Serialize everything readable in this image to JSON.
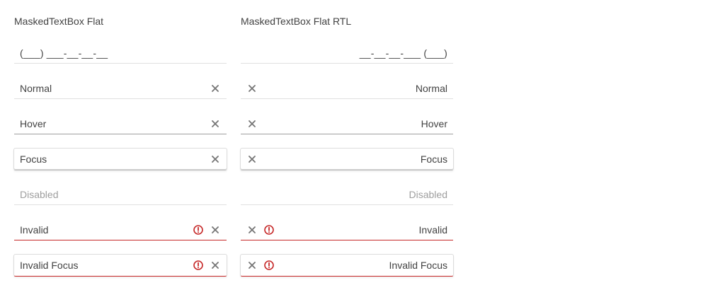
{
  "ltr": {
    "heading": "MaskedTextBox Flat",
    "mask": "(___) ___-__-__-__",
    "normal": "Normal",
    "hover": "Hover",
    "focus": "Focus",
    "disabled": "Disabled",
    "invalid": "Invalid",
    "invalid_focus": "Invalid Focus"
  },
  "rtl": {
    "heading": "MaskedTextBox Flat RTL",
    "mask": "__-__-__-___ (___)",
    "normal": "Normal",
    "hover": "Hover",
    "focus": "Focus",
    "disabled": "Disabled",
    "invalid": "Invalid",
    "invalid_focus": "Invalid Focus"
  },
  "icons": {
    "clear": "close-icon",
    "invalid": "exclamation-circle-icon"
  },
  "colors": {
    "text": "#424242",
    "muted": "#9e9e9e",
    "border": "#e0e0e0",
    "error": "#c62828",
    "icon": "#757575"
  }
}
